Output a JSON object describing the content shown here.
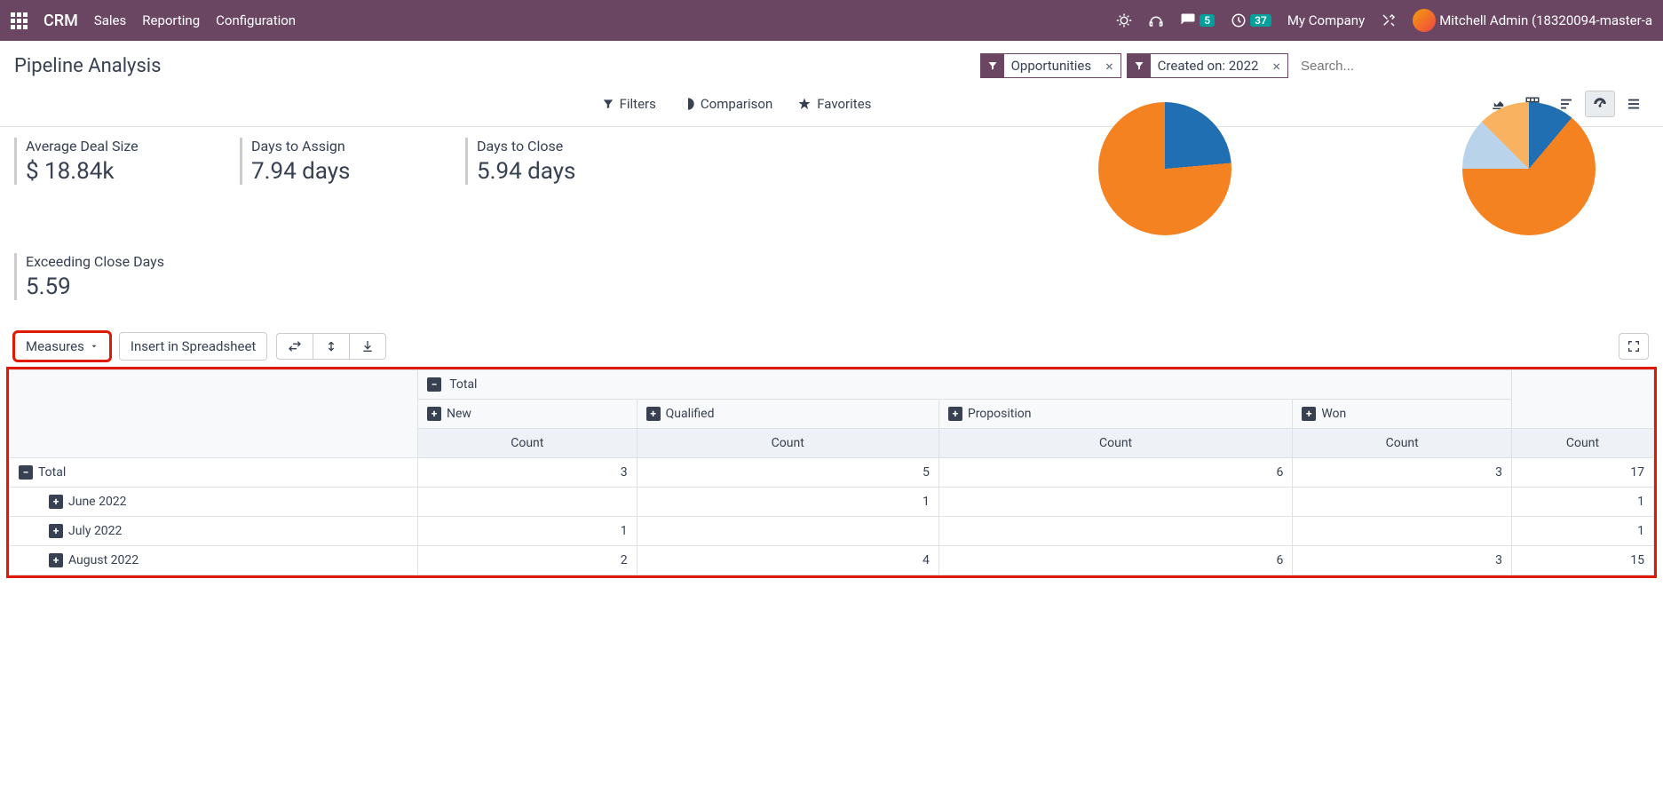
{
  "navbar": {
    "brand": "CRM",
    "links": [
      "Sales",
      "Reporting",
      "Configuration"
    ],
    "messages_badge": "5",
    "activities_badge": "37",
    "company": "My Company",
    "user": "Mitchell Admin (18320094-master-a"
  },
  "breadcrumb": {
    "title": "Pipeline Analysis"
  },
  "search": {
    "chips": [
      {
        "label": "Opportunities"
      },
      {
        "label": "Created on: 2022"
      }
    ],
    "placeholder": "Search...",
    "options": {
      "filters": "Filters",
      "comparison": "Comparison",
      "favorites": "Favorites"
    }
  },
  "kpis": {
    "avg_deal_label": "Average Deal Size",
    "avg_deal_value": "$ 18.84k",
    "days_assign_label": "Days to Assign",
    "days_assign_value": "7.94 days",
    "days_close_label": "Days to Close",
    "days_close_value": "5.94 days",
    "exceed_label": "Exceeding Close Days",
    "exceed_value": "5.59"
  },
  "pivot_toolbar": {
    "measures": "Measures",
    "insert": "Insert in Spreadsheet"
  },
  "pivot": {
    "total_header": "Total",
    "columns": [
      "New",
      "Qualified",
      "Proposition",
      "Won"
    ],
    "count_label": "Count",
    "rows": [
      {
        "label": "Total",
        "expanded": true,
        "indent": 0,
        "values": [
          "3",
          "5",
          "6",
          "3",
          "17"
        ]
      },
      {
        "label": "June 2022",
        "expanded": false,
        "indent": 1,
        "values": [
          "",
          "1",
          "",
          "",
          "1"
        ]
      },
      {
        "label": "July 2022",
        "expanded": false,
        "indent": 1,
        "values": [
          "1",
          "",
          "",
          "",
          "1"
        ]
      },
      {
        "label": "August 2022",
        "expanded": false,
        "indent": 1,
        "values": [
          "2",
          "4",
          "6",
          "3",
          "15"
        ]
      }
    ]
  }
}
